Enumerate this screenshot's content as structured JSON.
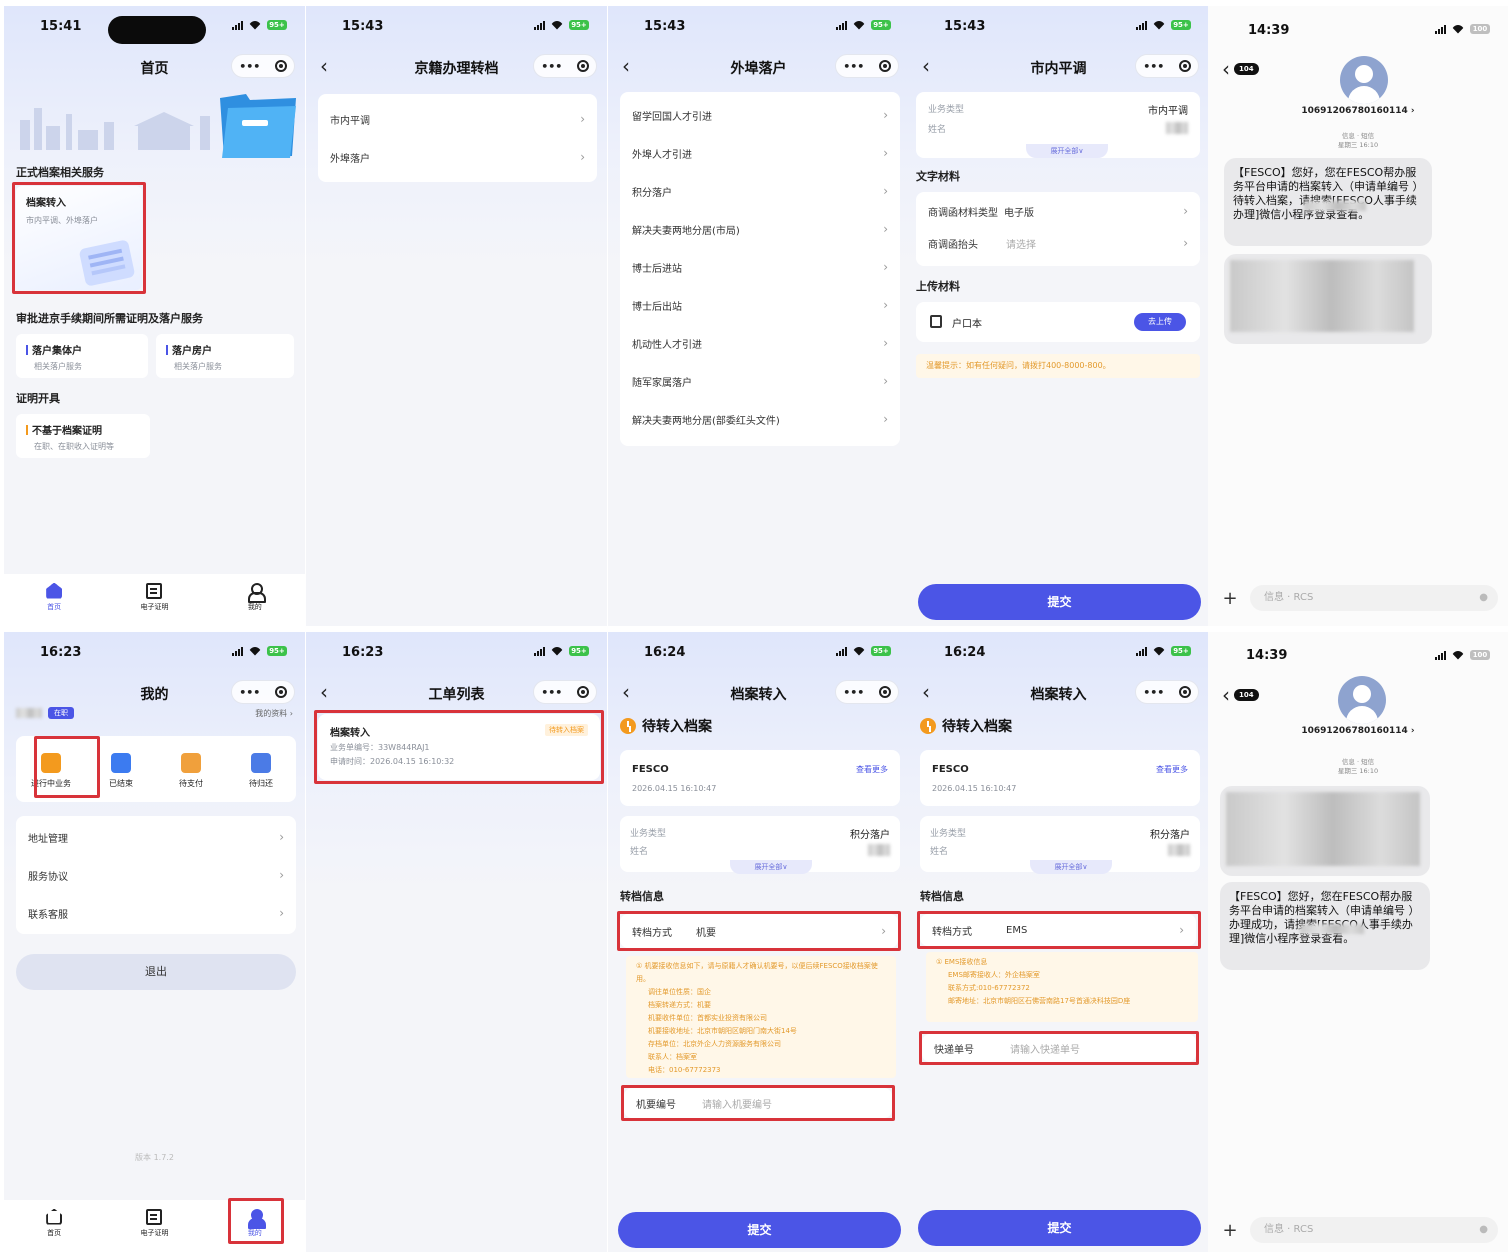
{
  "p1": {
    "time": "15:41",
    "battery": "95+",
    "title": "首页",
    "capsule_dots": "•••",
    "section_formal": "正式档案相关服务",
    "archive_in_title": "档案转入",
    "archive_in_sub": "市内平调、外埠落户",
    "section_approval": "审批进京手续期间所需证明及落户服务",
    "tile1_title": "落户集体户",
    "tile1_sub": "相关落户服务",
    "tile2_title": "落户房户",
    "tile2_sub": "相关落户服务",
    "section_cert": "证明开具",
    "tile3_title": "不基于档案证明",
    "tile3_sub": "在职、在职收入证明等",
    "tabs": [
      "首页",
      "电子证明",
      "我的"
    ]
  },
  "p2": {
    "time": "15:43",
    "battery": "95+",
    "title": "京籍办理转档",
    "items": [
      "市内平调",
      "外埠落户"
    ]
  },
  "p3": {
    "time": "15:43",
    "battery": "95+",
    "title": "外埠落户",
    "items": [
      "留学回国人才引进",
      "外埠人才引进",
      "积分落户",
      "解决夫妻两地分居(市局)",
      "博士后进站",
      "博士后出站",
      "机动性人才引进",
      "随军家属落户",
      "解决夫妻两地分居(部委红头文件)"
    ]
  },
  "p4": {
    "time": "15:43",
    "battery": "95+",
    "title": "市内平调",
    "biz_type_label": "业务类型",
    "biz_type_value": "市内平调",
    "name_label": "姓名",
    "expand": "展开全部∨",
    "section_text": "文字材料",
    "letter_type_label": "商调函材料类型",
    "letter_type_value": "电子版",
    "letter_head_label": "商调函抬头",
    "letter_head_value": "请选择",
    "section_upload": "上传材料",
    "hukou": "户口本",
    "upload_btn": "去上传",
    "tip": "温馨提示：如有任何疑问，请拨打400-8000-800。",
    "submit": "提交"
  },
  "p5": {
    "time": "14:39",
    "battery": "100",
    "back_count": "104",
    "sender": "10691206780160114 ›",
    "meta1": "信息 · 短信",
    "meta2": "星期三 16:10",
    "msg": "【FESCO】您好，您在FESCO帮办服务平台申请的档案转入（申请单编号          ）待转入档案，请搜索[FESCO人事手续办理]微信小程序登录查看。",
    "input_placeholder": "信息 · RCS"
  },
  "p6": {
    "time": "16:23",
    "battery": "95+",
    "title": "我的",
    "status_badge": "在职",
    "my_info": "我的资料 ›",
    "orders": [
      "进行中业务",
      "已结束",
      "待支付",
      "待归还"
    ],
    "menu": [
      "地址管理",
      "服务协议",
      "联系客服"
    ],
    "logout": "退出",
    "version": "版本 1.7.2",
    "tabs": [
      "首页",
      "电子证明",
      "我的"
    ]
  },
  "p7": {
    "time": "16:23",
    "battery": "95+",
    "title": "工单列表",
    "order_title": "档案转入",
    "order_badge": "待转入档案",
    "order_no": "业务单编号：33W844RAJ1",
    "order_time": "申请时间：2026.04.15 16:10:32"
  },
  "p8": {
    "time": "16:24",
    "battery": "95+",
    "title": "档案转入",
    "status": "待转入档案",
    "org": "FESCO",
    "org_time": "2026.04.15 16:10:47",
    "more": "查看更多",
    "biz_type_label": "业务类型",
    "biz_type_value": "积分落户",
    "name_label": "姓名",
    "expand": "展开全部∨",
    "section_transfer": "转档信息",
    "method_label": "转档方式",
    "method_value": "机要",
    "notice": [
      "① 机要接收信息如下，请与原籍人才确认机要号，以便后续FESCO接收档案使用。",
      "调往单位性质：国企",
      "档案转递方式：机要",
      "机要收件单位：首都实业投资有限公司",
      "机要接收地址：北京市朝阳区朝阳门南大街14号",
      "存档单位：北京外企人力资源服务有限公司",
      "联系人：档案室",
      "电话：010-67772373"
    ],
    "code_label": "机要编号",
    "code_placeholder": "请输入机要编号",
    "submit": "提交"
  },
  "p9": {
    "time": "16:24",
    "battery": "95+",
    "title": "档案转入",
    "status": "待转入档案",
    "org": "FESCO",
    "org_time": "2026.04.15 16:10:47",
    "more": "查看更多",
    "biz_type_label": "业务类型",
    "biz_type_value": "积分落户",
    "name_label": "姓名",
    "expand": "展开全部∨",
    "section_transfer": "转档信息",
    "method_label": "转档方式",
    "method_value": "EMS",
    "notice": [
      "① EMS接收信息",
      "EMS邮寄接收人：外企档案室",
      "联系方式:010-67772372",
      "邮寄地址：北京市朝阳区石佛营南路17号首通决科技园D座"
    ],
    "track_label": "快递单号",
    "track_placeholder": "请输入快递单号",
    "submit": "提交"
  },
  "p10": {
    "time": "14:39",
    "battery": "100",
    "back_count": "104",
    "sender": "10691206780160114 ›",
    "meta1": "信息 · 短信",
    "meta2": "星期三 16:10",
    "msg": "【FESCO】您好，您在FESCO帮办服务平台申请的档案转入（申请单编号          ）办理成功，请搜索[FESCO人事手续办理]微信小程序登录查看。",
    "input_placeholder": "信息 · RCS"
  },
  "colors": {
    "accent": "#4b55e6",
    "highlight": "#d8333a",
    "warning": "#f39a1e",
    "battery": "#3cc24a"
  }
}
